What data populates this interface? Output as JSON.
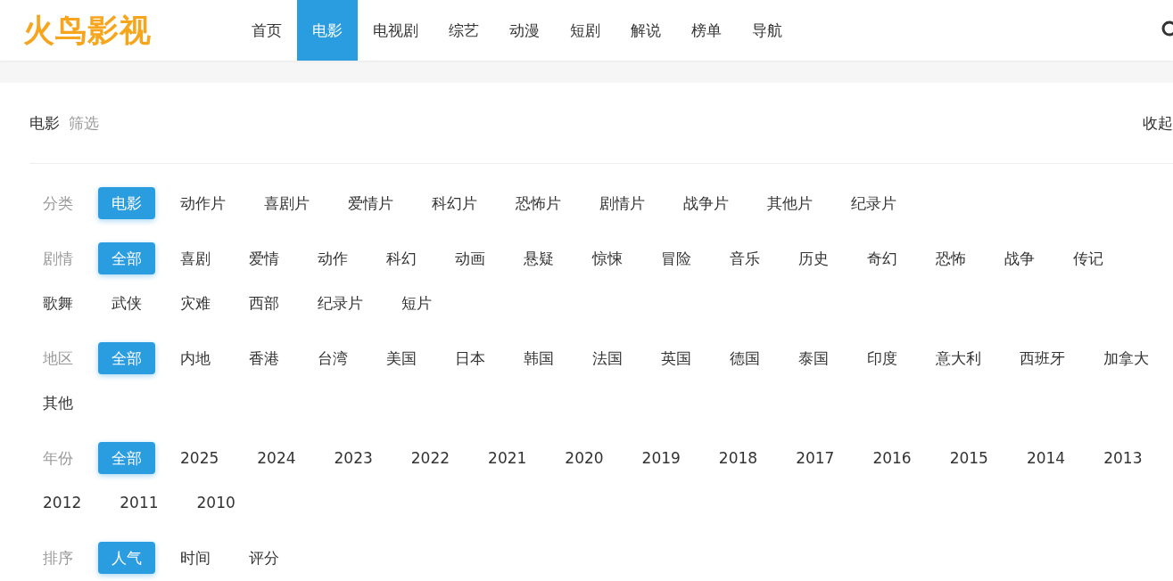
{
  "logo": "火鸟影视",
  "nav": [
    {
      "label": "首页",
      "selected": false
    },
    {
      "label": "电影",
      "selected": true
    },
    {
      "label": "电视剧",
      "selected": false
    },
    {
      "label": "综艺",
      "selected": false
    },
    {
      "label": "动漫",
      "selected": false
    },
    {
      "label": "短剧",
      "selected": false
    },
    {
      "label": "解说",
      "selected": false
    },
    {
      "label": "榜单",
      "selected": false
    },
    {
      "label": "导航",
      "selected": false
    }
  ],
  "section": {
    "title": "电影",
    "subtitle": "筛选",
    "toggle": "收起"
  },
  "filters": [
    {
      "label": "分类",
      "options": [
        {
          "text": "电影",
          "selected": true
        },
        {
          "text": "动作片",
          "selected": false
        },
        {
          "text": "喜剧片",
          "selected": false
        },
        {
          "text": "爱情片",
          "selected": false
        },
        {
          "text": "科幻片",
          "selected": false
        },
        {
          "text": "恐怖片",
          "selected": false
        },
        {
          "text": "剧情片",
          "selected": false
        },
        {
          "text": "战争片",
          "selected": false
        },
        {
          "text": "其他片",
          "selected": false
        },
        {
          "text": "纪录片",
          "selected": false
        }
      ]
    },
    {
      "label": "剧情",
      "options": [
        {
          "text": "全部",
          "selected": true
        },
        {
          "text": "喜剧",
          "selected": false
        },
        {
          "text": "爱情",
          "selected": false
        },
        {
          "text": "动作",
          "selected": false
        },
        {
          "text": "科幻",
          "selected": false
        },
        {
          "text": "动画",
          "selected": false
        },
        {
          "text": "悬疑",
          "selected": false
        },
        {
          "text": "惊悚",
          "selected": false
        },
        {
          "text": "冒险",
          "selected": false
        },
        {
          "text": "音乐",
          "selected": false
        },
        {
          "text": "历史",
          "selected": false
        },
        {
          "text": "奇幻",
          "selected": false
        },
        {
          "text": "恐怖",
          "selected": false
        },
        {
          "text": "战争",
          "selected": false
        },
        {
          "text": "传记",
          "selected": false
        },
        {
          "text": "歌舞",
          "selected": false
        },
        {
          "text": "武侠",
          "selected": false
        },
        {
          "text": "灾难",
          "selected": false
        },
        {
          "text": "西部",
          "selected": false
        },
        {
          "text": "纪录片",
          "selected": false
        },
        {
          "text": "短片",
          "selected": false
        }
      ]
    },
    {
      "label": "地区",
      "options": [
        {
          "text": "全部",
          "selected": true
        },
        {
          "text": "内地",
          "selected": false
        },
        {
          "text": "香港",
          "selected": false
        },
        {
          "text": "台湾",
          "selected": false
        },
        {
          "text": "美国",
          "selected": false
        },
        {
          "text": "日本",
          "selected": false
        },
        {
          "text": "韩国",
          "selected": false
        },
        {
          "text": "法国",
          "selected": false
        },
        {
          "text": "英国",
          "selected": false
        },
        {
          "text": "德国",
          "selected": false
        },
        {
          "text": "泰国",
          "selected": false
        },
        {
          "text": "印度",
          "selected": false
        },
        {
          "text": "意大利",
          "selected": false
        },
        {
          "text": "西班牙",
          "selected": false
        },
        {
          "text": "加拿大",
          "selected": false
        },
        {
          "text": "其他",
          "selected": false
        }
      ]
    },
    {
      "label": "年份",
      "options": [
        {
          "text": "全部",
          "selected": true
        },
        {
          "text": "2025",
          "selected": false
        },
        {
          "text": "2024",
          "selected": false
        },
        {
          "text": "2023",
          "selected": false
        },
        {
          "text": "2022",
          "selected": false
        },
        {
          "text": "2021",
          "selected": false
        },
        {
          "text": "2020",
          "selected": false
        },
        {
          "text": "2019",
          "selected": false
        },
        {
          "text": "2018",
          "selected": false
        },
        {
          "text": "2017",
          "selected": false
        },
        {
          "text": "2016",
          "selected": false
        },
        {
          "text": "2015",
          "selected": false
        },
        {
          "text": "2014",
          "selected": false
        },
        {
          "text": "2013",
          "selected": false
        },
        {
          "text": "2012",
          "selected": false
        },
        {
          "text": "2011",
          "selected": false
        },
        {
          "text": "2010",
          "selected": false
        }
      ]
    },
    {
      "label": "排序",
      "options": [
        {
          "text": "人气",
          "selected": true
        },
        {
          "text": "时间",
          "selected": false
        },
        {
          "text": "评分",
          "selected": false
        }
      ]
    }
  ]
}
